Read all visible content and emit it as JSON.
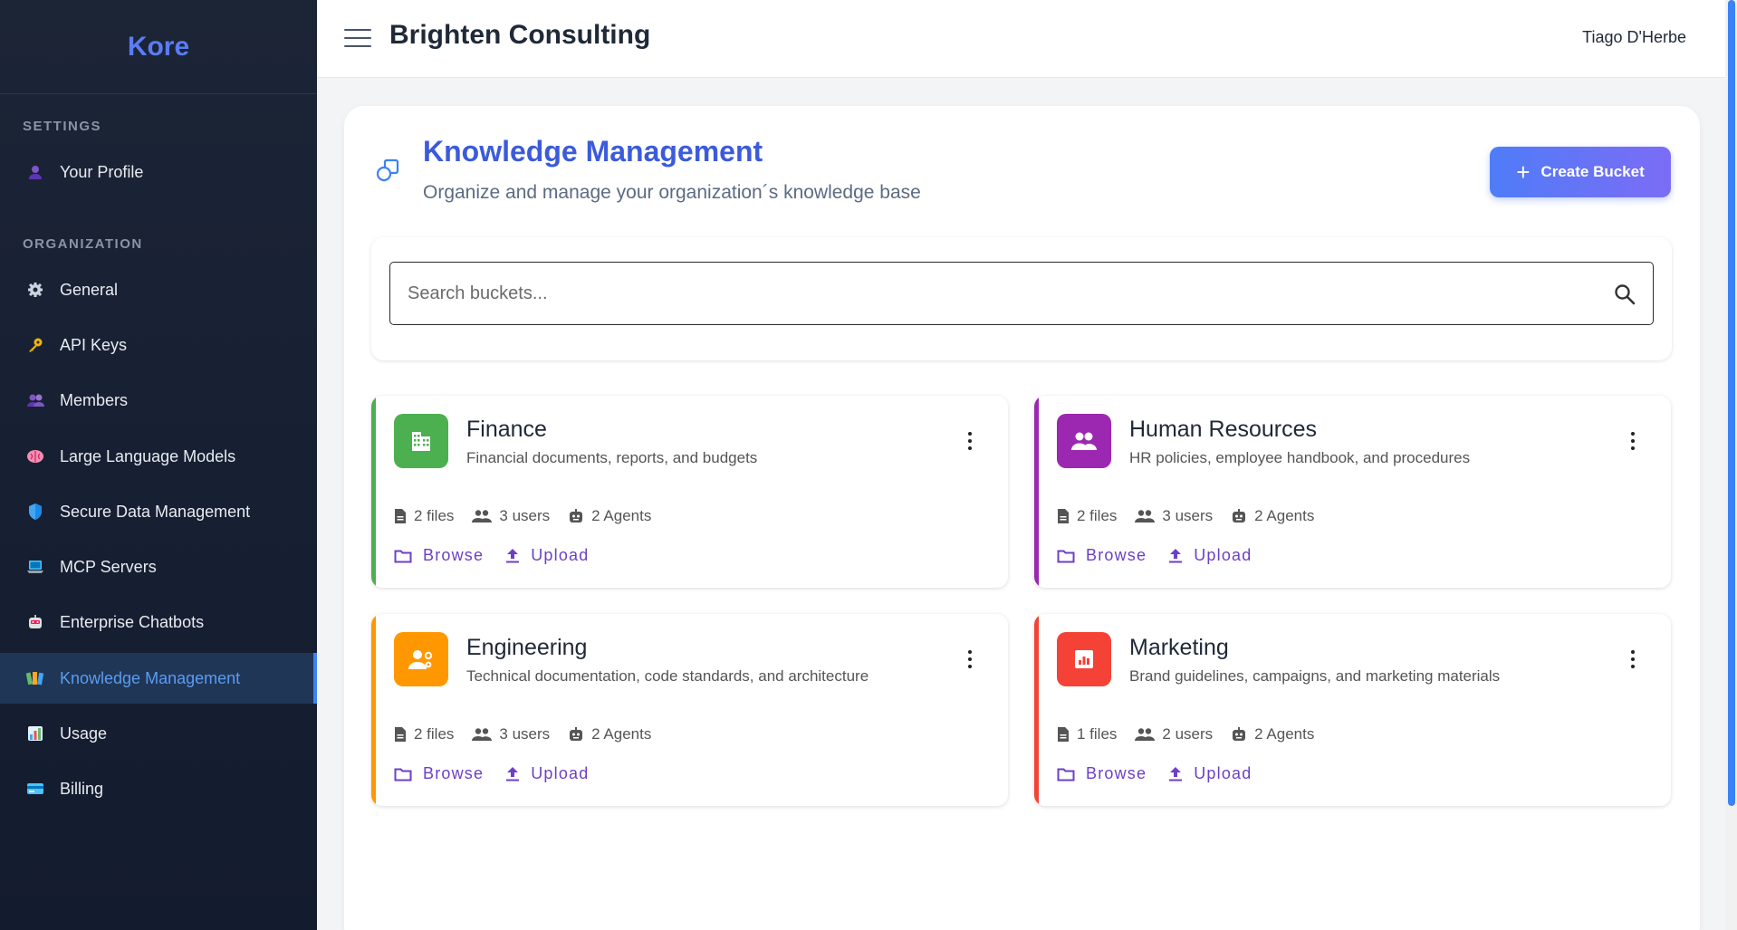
{
  "sidebar": {
    "brand": "Kore",
    "settings_title": "SETTINGS",
    "organization_title": "ORGANIZATION",
    "items": [
      {
        "label": "Your Profile",
        "icon": "user-icon"
      },
      {
        "label": "General",
        "icon": "gear-icon"
      },
      {
        "label": "API Keys",
        "icon": "key-icon"
      },
      {
        "label": "Members",
        "icon": "members-icon"
      },
      {
        "label": "Large Language Models",
        "icon": "brain-icon"
      },
      {
        "label": "Secure Data Management",
        "icon": "shield-icon"
      },
      {
        "label": "MCP Servers",
        "icon": "laptop-icon"
      },
      {
        "label": "Enterprise Chatbots",
        "icon": "robot-icon"
      },
      {
        "label": "Knowledge Management",
        "icon": "books-icon",
        "active": true
      },
      {
        "label": "Usage",
        "icon": "chart-icon"
      },
      {
        "label": "Billing",
        "icon": "card-icon"
      }
    ]
  },
  "header": {
    "org_name": "Brighten Consulting",
    "user_name": "Tiago D'Herbe"
  },
  "page": {
    "title": "Knowledge Management",
    "subtitle": "Organize and manage your organization´s knowledge base",
    "create_label": "Create Bucket",
    "search_placeholder": "Search buckets..."
  },
  "buckets": [
    {
      "name": "Finance",
      "description": "Financial documents, reports, and budgets",
      "files": "2 files",
      "users": "3 users",
      "agents": "2 Agents",
      "color": "#4caf50",
      "icon": "building-icon"
    },
    {
      "name": "Human Resources",
      "description": "HR policies, employee handbook, and procedures",
      "files": "2 files",
      "users": "3 users",
      "agents": "2 Agents",
      "color": "#9c27b0",
      "icon": "people-icon"
    },
    {
      "name": "Engineering",
      "description": "Technical documentation, code standards, and architecture",
      "files": "2 files",
      "users": "3 users",
      "agents": "2 Agents",
      "color": "#ff9800",
      "icon": "engineer-icon"
    },
    {
      "name": "Marketing",
      "description": "Brand guidelines, campaigns, and marketing materials",
      "files": "1 files",
      "users": "2 users",
      "agents": "2 Agents",
      "color": "#f44336",
      "icon": "analytics-icon"
    }
  ],
  "actions": {
    "browse": "Browse",
    "upload": "Upload"
  }
}
